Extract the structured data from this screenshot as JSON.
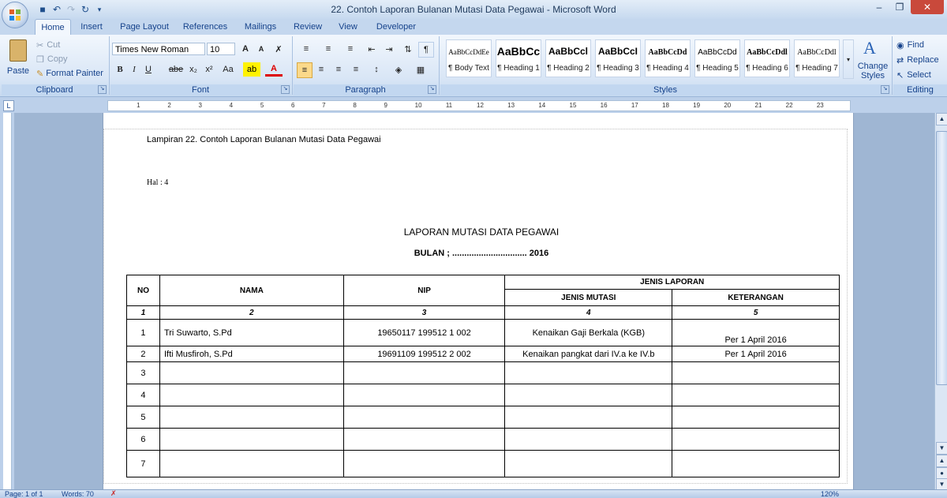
{
  "window": {
    "title": "22. Contoh Laporan Bulanan Mutasi Data Pegawai - Microsoft Word",
    "buttons": [
      "minimize-icon",
      "restore-icon",
      "close-icon"
    ]
  },
  "tabs": [
    "Home",
    "Insert",
    "Page Layout",
    "References",
    "Mailings",
    "Review",
    "View",
    "Developer"
  ],
  "ribbon": {
    "clipboard": {
      "paste": "Paste",
      "cut": "Cut",
      "copy": "Copy",
      "format_painter": "Format Painter",
      "label": "Clipboard"
    },
    "font": {
      "family": "Times New Roman",
      "size": "10",
      "label": "Font",
      "bold": "B",
      "italic": "I",
      "underline": "U",
      "strike": "abe",
      "sub": "x₂",
      "sup": "x²",
      "case": "Aa",
      "grow": "A",
      "shrink": "A"
    },
    "paragraph": {
      "label": "Paragraph",
      "pilcrow": "¶"
    },
    "styles": {
      "label": "Styles",
      "items": [
        {
          "sample": "AaBbCcDdEe",
          "name": "¶ Body Text"
        },
        {
          "sample": "AaBbCc",
          "name": "¶ Heading 1"
        },
        {
          "sample": "AaBbCcl",
          "name": "¶ Heading 2"
        },
        {
          "sample": "AaBbCcI",
          "name": "¶ Heading 3"
        },
        {
          "sample": "AaBbCcDd",
          "name": "¶ Heading 4"
        },
        {
          "sample": "AaBbCcDd",
          "name": "¶ Heading 5"
        },
        {
          "sample": "AaBbCcDdl",
          "name": "¶ Heading 6"
        },
        {
          "sample": "AaBbCcDdl",
          "name": "¶ Heading 7"
        }
      ],
      "change_styles": "Change Styles"
    },
    "editing": {
      "label": "Editing",
      "find": "Find",
      "replace": "Replace",
      "select": "Select"
    }
  },
  "ruler": {
    "ticks": [
      "1",
      "2",
      "3",
      "4",
      "5",
      "6",
      "7",
      "8",
      "9",
      "10",
      "11",
      "12",
      "13",
      "14",
      "15",
      "16",
      "17",
      "18",
      "19",
      "20",
      "21",
      "22",
      "23"
    ]
  },
  "document": {
    "lampiran": "Lampiran 22. Contoh Laporan Bulanan Mutasi Data Pegawai",
    "hal": "Hal : 4",
    "title": "LAPORAN MUTASI DATA PEGAWAI",
    "bulan": "BULAN ; ............................... 2016",
    "table": {
      "headers": {
        "no": "NO",
        "nama": "NAMA",
        "nip": "NIP",
        "jenis_laporan": "JENIS LAPORAN",
        "jenis_mutasi": "JENIS MUTASI",
        "keterangan": "KETERANGAN"
      },
      "numbering": [
        "1",
        "2",
        "3",
        "4",
        "5"
      ],
      "rows": [
        {
          "no": "1",
          "nama": "Tri Suwarto, S.Pd",
          "nip": "19650117  199512  1 002",
          "mutasi": "Kenaikan Gaji Berkala  (KGB)",
          "ket": "Per 1 April 2016"
        },
        {
          "no": "2",
          "nama": "Ifti Musfiroh, S.Pd",
          "nip": "19691109  199512  2 002",
          "mutasi": "Kenaikan pangkat dari IV.a ke IV.b",
          "ket": "Per 1 April 2016"
        },
        {
          "no": "3",
          "nama": "",
          "nip": "",
          "mutasi": "",
          "ket": ""
        },
        {
          "no": "4",
          "nama": "",
          "nip": "",
          "mutasi": "",
          "ket": ""
        },
        {
          "no": "5",
          "nama": "",
          "nip": "",
          "mutasi": "",
          "ket": ""
        },
        {
          "no": "6",
          "nama": "",
          "nip": "",
          "mutasi": "",
          "ket": ""
        },
        {
          "no": "7",
          "nama": "",
          "nip": "",
          "mutasi": "",
          "ket": ""
        }
      ]
    }
  },
  "status": {
    "page": "Page: 1 of 1",
    "words": "Words: 70",
    "zoom": "120%"
  }
}
